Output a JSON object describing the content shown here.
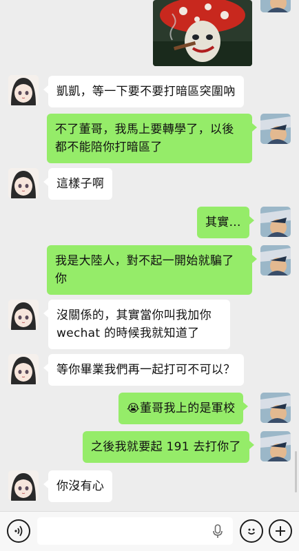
{
  "chat": {
    "messages": [
      {
        "side": "in",
        "text": "凱凱，等一下要不要打暗區突圍吶"
      },
      {
        "side": "out",
        "line1": "不了董哥，我馬上要轉學了，以後",
        "line2": "都不能陪你打暗區了"
      },
      {
        "side": "in",
        "text": "這樣子啊"
      },
      {
        "side": "out",
        "text": "其實..."
      },
      {
        "side": "out",
        "line1": "我是大陸人，對不起一開始就騙了",
        "line2": "你"
      },
      {
        "side": "in",
        "line1": "沒關係的，其實當你叫我加你",
        "line2": "wechat 的時候我就知道了"
      },
      {
        "side": "in",
        "text": "等你畢業我們再一起打可不可以？"
      },
      {
        "side": "out",
        "emoji": "😭",
        "text": "董哥我上的是軍校"
      },
      {
        "side": "out",
        "text": "之後我就要起 191 去打你了"
      },
      {
        "side": "in",
        "text": "你沒有心"
      }
    ]
  },
  "input": {
    "value": "",
    "placeholder": ""
  },
  "icons": {
    "voice": "voice-icon",
    "mic": "microphone-icon",
    "emoji": "emoji-icon",
    "plus": "plus-icon"
  },
  "colors": {
    "background": "#ededed",
    "outgoing_bubble": "#95ec69",
    "incoming_bubble": "#ffffff",
    "input_bar": "#f7f7f7"
  }
}
